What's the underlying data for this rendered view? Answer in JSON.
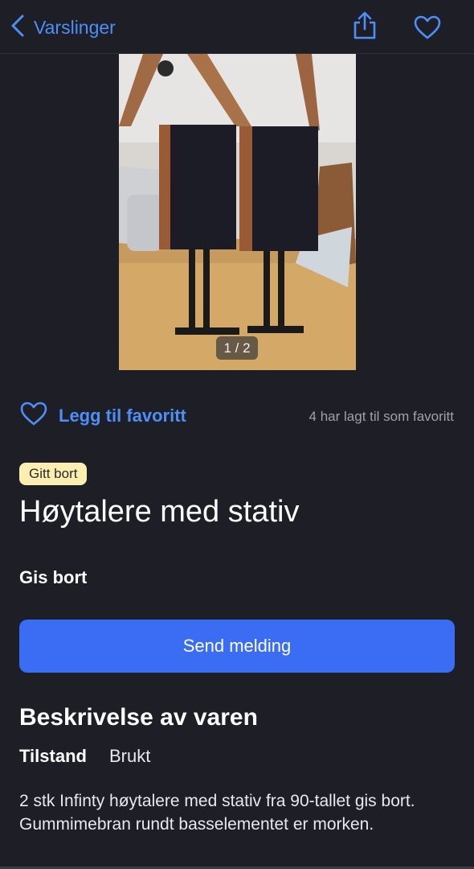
{
  "nav": {
    "back_label": "Varslinger",
    "share_icon": "share-icon",
    "favorite_icon": "heart-outline-icon"
  },
  "gallery": {
    "counter": "1 / 2",
    "image_description_icon": "photo"
  },
  "favorite": {
    "label": "Legg til favoritt",
    "count_text": "4 har lagt til som favoritt"
  },
  "listing": {
    "status_badge": "Gitt bort",
    "title": "Høytalere med stativ",
    "price_text": "Gis bort",
    "send_button": "Send melding"
  },
  "description": {
    "heading": "Beskrivelse av varen",
    "condition_label": "Tilstand",
    "condition_value": "Brukt",
    "text": "2 stk Infinty høytalere med stativ fra 90-tallet gis bort. Gummimebran rundt basselementet er morken."
  },
  "colors": {
    "background": "#1d1e26",
    "accent": "#4e8ff7",
    "button": "#3a6cf4",
    "badge": "#fcedb0"
  }
}
